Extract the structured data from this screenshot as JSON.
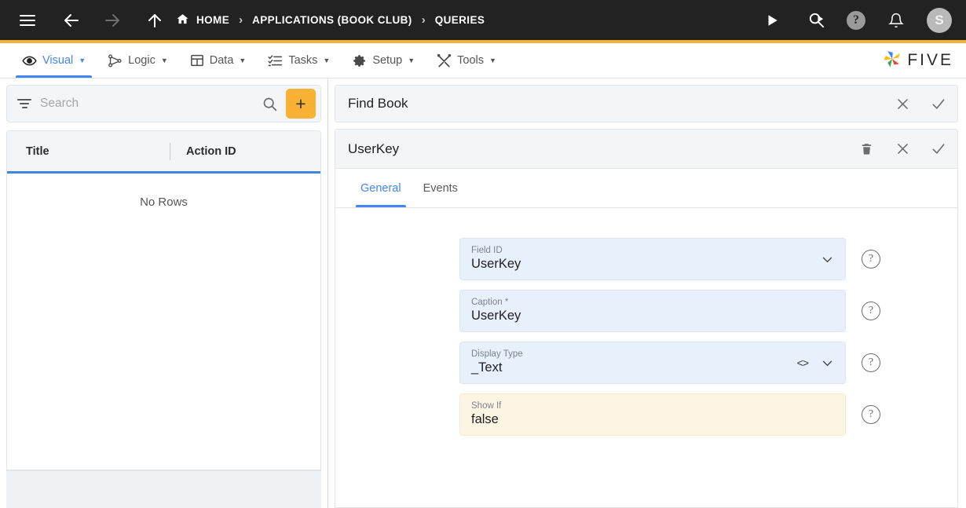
{
  "topbar": {
    "menu_icon": "hamburger-icon",
    "back_icon": "arrow-left-icon",
    "forward_icon": "arrow-right-icon",
    "up_icon": "arrow-up-icon",
    "breadcrumbs": [
      {
        "label": "HOME",
        "icon": "home-icon"
      },
      {
        "label": "APPLICATIONS (BOOK CLUB)",
        "icon": ""
      },
      {
        "label": "QUERIES",
        "icon": ""
      }
    ],
    "separator": "›",
    "run_icon": "play-icon",
    "search_run_icon": "search-play-icon",
    "help_icon": "help-circle-icon",
    "help_glyph": "?",
    "bell_icon": "bell-icon",
    "avatar_initial": "S",
    "accent_color": "#f5b335",
    "background_color": "#222222"
  },
  "menubar": {
    "items": [
      {
        "label": "Visual",
        "icon": "eye-icon",
        "caret": "▼",
        "active": true
      },
      {
        "label": "Logic",
        "icon": "logic-nodes-icon",
        "caret": "▼",
        "active": false
      },
      {
        "label": "Data",
        "icon": "table-grid-icon",
        "caret": "▼",
        "active": false
      },
      {
        "label": "Tasks",
        "icon": "checklist-icon",
        "caret": "▼",
        "active": false
      },
      {
        "label": "Setup",
        "icon": "gear-icon",
        "caret": "▼",
        "active": false
      },
      {
        "label": "Tools",
        "icon": "tools-icon",
        "caret": "▼",
        "active": false
      }
    ],
    "active_color": "#4285f4",
    "brand": {
      "name": "FIVE",
      "logo_icon": "five-pinwheel-logo"
    }
  },
  "sidebar": {
    "search": {
      "placeholder": "Search",
      "value": "",
      "filter_icon": "filter-icon",
      "search_icon": "magnifier-icon"
    },
    "add_button": {
      "label": "+",
      "name": "add-button",
      "color": "#f9b233"
    },
    "table": {
      "columns": [
        "Title",
        "Action ID"
      ],
      "rows": [],
      "empty_message": "No Rows",
      "header_underline_color": "#3f86d8"
    }
  },
  "main": {
    "panel": {
      "title": "Find Book",
      "actions": [
        {
          "icon": "close-icon",
          "glyph": "✕",
          "name": "close-button"
        },
        {
          "icon": "check-icon",
          "glyph": "✓",
          "name": "confirm-button"
        }
      ]
    },
    "inner": {
      "title": "UserKey",
      "actions": [
        {
          "icon": "trash-icon",
          "glyph": "",
          "name": "delete-button"
        },
        {
          "icon": "close-icon",
          "glyph": "✕",
          "name": "close-button"
        },
        {
          "icon": "check-icon",
          "glyph": "✓",
          "name": "confirm-button"
        }
      ],
      "tabs": [
        {
          "label": "General",
          "active": true
        },
        {
          "label": "Events",
          "active": false
        }
      ],
      "fields": [
        {
          "label": "Field ID",
          "value": "UserKey",
          "style": "blue",
          "dropdown": true,
          "code_icon": false,
          "help": "?"
        },
        {
          "label": "Caption *",
          "value": "UserKey",
          "style": "blue",
          "dropdown": false,
          "code_icon": false,
          "help": "?"
        },
        {
          "label": "Display Type",
          "value": "_Text",
          "style": "blue",
          "dropdown": true,
          "code_icon": true,
          "help": "?"
        },
        {
          "label": "Show If",
          "value": "false",
          "style": "cream",
          "dropdown": false,
          "code_icon": false,
          "help": "?"
        }
      ]
    }
  }
}
